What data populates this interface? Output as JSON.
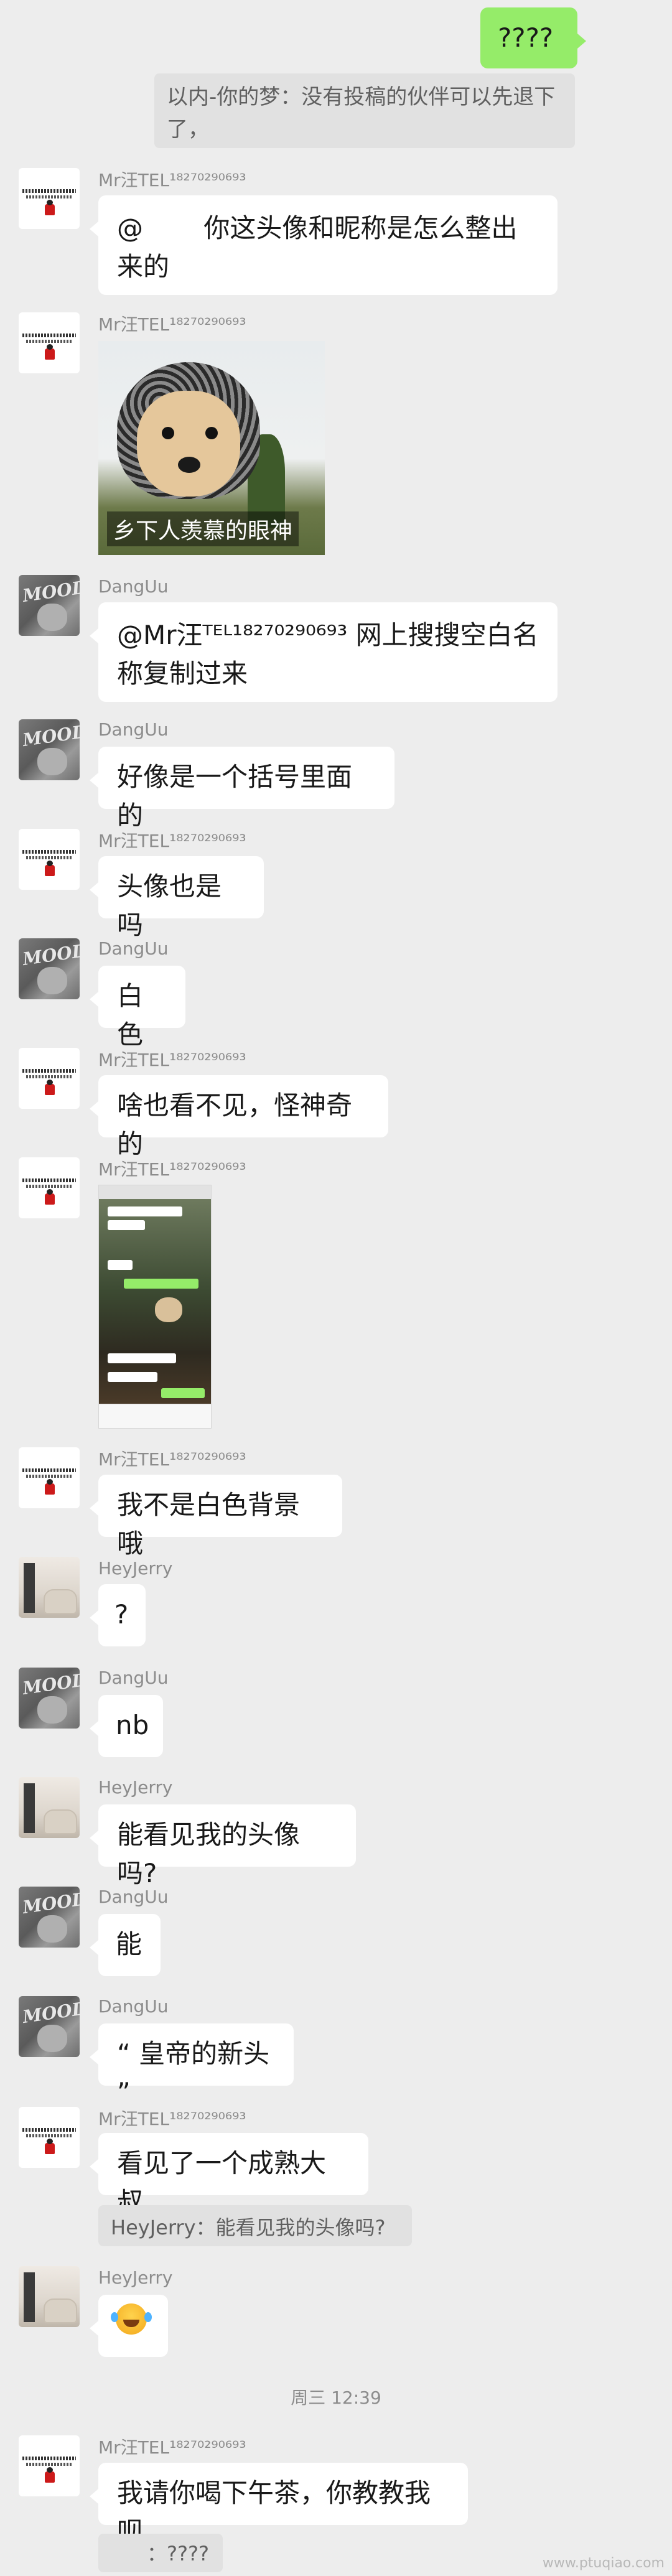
{
  "top_message": {
    "text": "????",
    "quote": "以内-你的梦：没有投稿的伙伴可以先退下了，"
  },
  "users": {
    "mr": {
      "name": "Mr汪",
      "tel": "TEL¹⁸²⁷⁰²⁹⁰⁶⁹³"
    },
    "dang": {
      "name": "DangUu"
    },
    "jerry": {
      "name": "HeyJerry"
    }
  },
  "avatar_text": {
    "mood": "MOOD"
  },
  "messages": {
    "m1": "@　　 你这头像和昵称是怎么整出来的",
    "m2_caption": "乡下人羡慕的眼神",
    "m3": "@Mr汪ᵀᴱᴸ¹⁸²⁷⁰²⁹⁰⁶⁹³ 网上搜搜空白名称复制过来",
    "m4": "好像是一个括号里面的",
    "m5": "头像也是吗",
    "m6": "白色",
    "m7": "啥也看不见，怪神奇的",
    "m9": "我不是白色背景哦",
    "m10": "?",
    "m11": "nb",
    "m12": "能看见我的头像吗?",
    "m13": "能",
    "m14": "“ 皇帝的新头 ”",
    "m15": "看见了一个成熟大叔",
    "m15_quote": "HeyJerry：能看见我的头像吗?",
    "m17": "我请你喝下午茶，你教教我呗",
    "m17_quote": "：????"
  },
  "time_separator": "周三 12:39",
  "watermark": "www.ptuqiao.com",
  "icons": [
    "mood-avatar",
    "blank-white-avatar",
    "chair-avatar",
    "laughing-emoji"
  ],
  "colors": {
    "background": "#ededed",
    "self_bubble": "#95ec69",
    "other_bubble": "#ffffff"
  }
}
